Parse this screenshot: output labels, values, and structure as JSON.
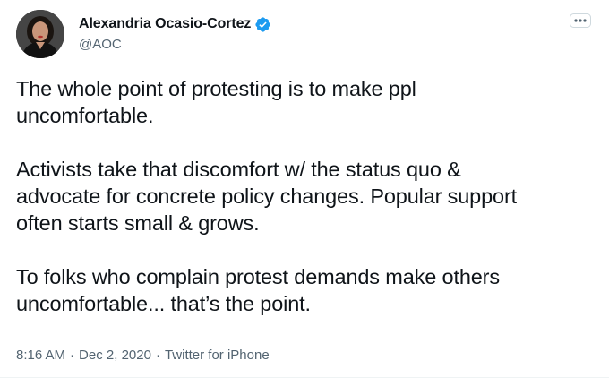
{
  "tweet": {
    "author": {
      "display_name": "Alexandria Ocasio-Cortez",
      "handle": "@AOC",
      "verified_icon": "verified-badge-icon",
      "avatar_icon": "profile-avatar"
    },
    "more_icon": "more-options-icon",
    "paragraphs": [
      "The whole point of protesting is to make ppl\nuncomfortable.",
      "Activists take that discomfort w/ the status quo &\nadvocate for concrete policy changes. Popular support\noften starts small & grows.",
      "To folks who complain protest demands make others\nuncomfortable... that’s the point."
    ],
    "meta": {
      "time": "8:16 AM",
      "separator": "·",
      "date": "Dec 2, 2020",
      "source": "Twitter for iPhone"
    }
  },
  "colors": {
    "text_primary": "#0f1419",
    "text_secondary": "#536471",
    "verified_blue": "#1d9bf0",
    "background": "#ffffff"
  }
}
